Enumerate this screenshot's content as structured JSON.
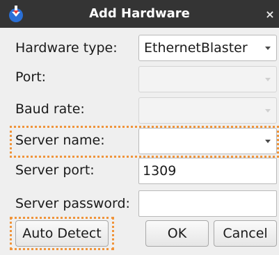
{
  "window": {
    "title": "Add Hardware",
    "app_icon": "quartus-icon",
    "close_label": "×"
  },
  "form": {
    "hardware_type": {
      "label": "Hardware type:",
      "value": "EthernetBlaster"
    },
    "port": {
      "label": "Port:",
      "value": ""
    },
    "baud_rate": {
      "label": "Baud rate:",
      "value": ""
    },
    "server_name": {
      "label": "Server name:",
      "value": ""
    },
    "server_port": {
      "label": "Server port:",
      "value": "1309"
    },
    "server_password": {
      "label": "Server password:",
      "value": ""
    }
  },
  "buttons": {
    "auto_detect": "Auto Detect",
    "ok": "OK",
    "cancel": "Cancel"
  },
  "annotations": {
    "highlight_color": "#f0943a"
  }
}
